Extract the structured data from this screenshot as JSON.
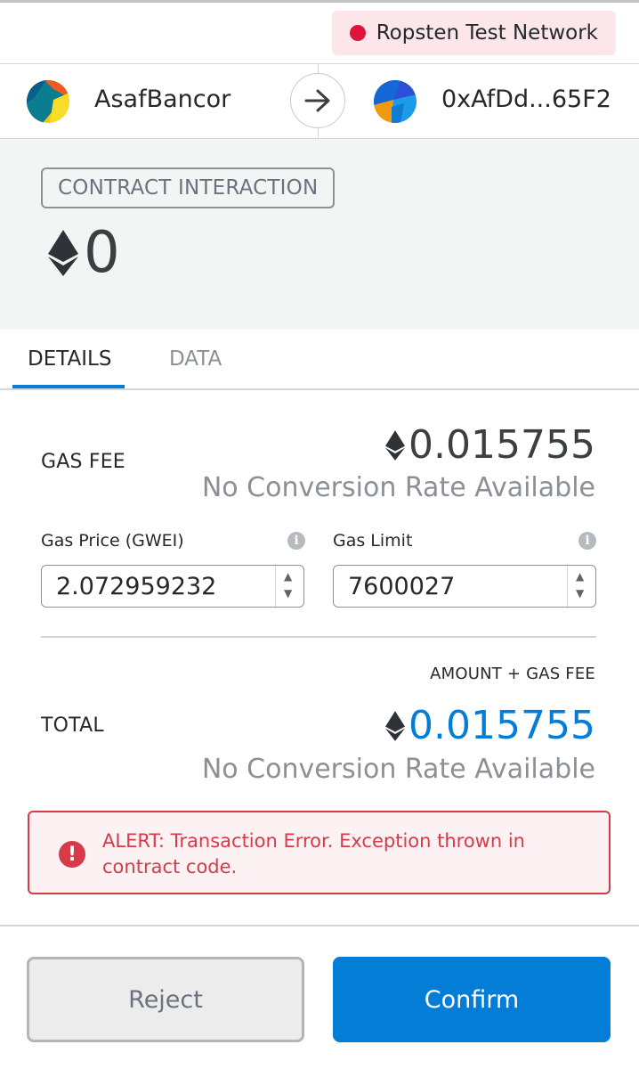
{
  "header": {
    "network_label": "Ropsten Test Network",
    "network_color": "#e0133a"
  },
  "parties": {
    "sender_name": "AsafBancor",
    "recipient_name": "0xAfDd...65F2",
    "arrow_icon": "arrow-right-icon"
  },
  "summary": {
    "badge": "CONTRACT INTERACTION",
    "amount": "0",
    "currency_icon": "ethereum-icon"
  },
  "tabs": [
    {
      "label": "DETAILS",
      "active": true
    },
    {
      "label": "DATA",
      "active": false
    }
  ],
  "details": {
    "gas_fee_label": "GAS FEE",
    "gas_fee_value": "0.015755",
    "gas_fee_conversion": "No Conversion Rate Available",
    "gas_price_label": "Gas Price (GWEI)",
    "gas_price_value": "2.072959232",
    "gas_limit_label": "Gas Limit",
    "gas_limit_value": "7600027",
    "amount_gas_label": "AMOUNT + GAS FEE",
    "total_label": "TOTAL",
    "total_value": "0.015755",
    "total_conversion": "No Conversion Rate Available",
    "total_color": "#037dd6"
  },
  "alert": {
    "text": "ALERT: Transaction Error. Exception thrown in contract code.",
    "color": "#d73a49"
  },
  "footer": {
    "reject_label": "Reject",
    "confirm_label": "Confirm",
    "confirm_color": "#037dd6"
  }
}
